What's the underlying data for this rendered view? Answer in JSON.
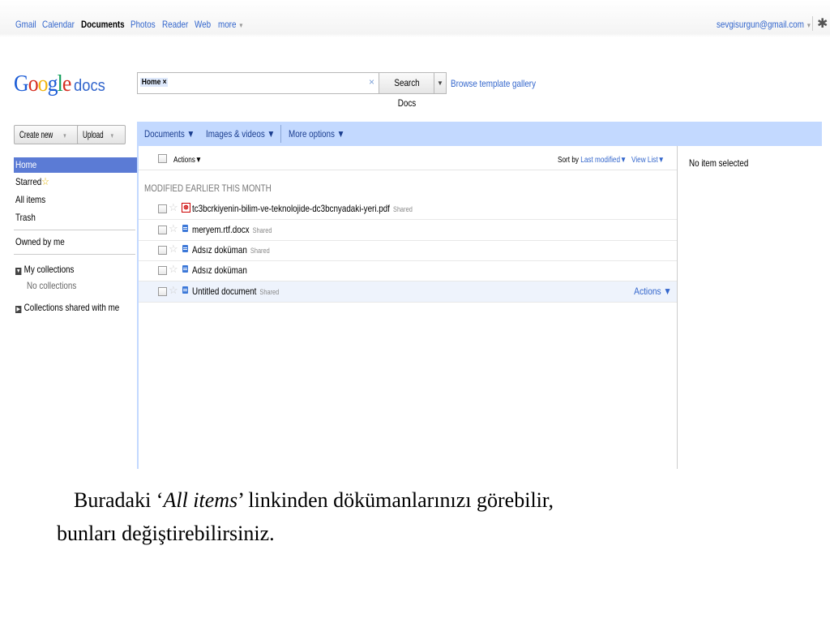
{
  "topnav": {
    "links": [
      "Gmail",
      "Calendar",
      "Documents",
      "Photos",
      "Reader",
      "Web",
      "more"
    ],
    "account": "sevgisurgun@gmail.com"
  },
  "logo": {
    "google": "Google",
    "docs": "docs"
  },
  "search": {
    "chip": "Home ×",
    "button": "Search Docs",
    "browse": "Browse template gallery"
  },
  "left_buttons": {
    "create": "Create new",
    "upload": "Upload"
  },
  "toolbar": {
    "documents": "Documents ▼",
    "images": "Images & videos ▼",
    "more": "More options ▼"
  },
  "nav": {
    "home": "Home",
    "starred": "Starred",
    "all_items": "All items",
    "trash": "Trash",
    "owned": "Owned by me",
    "my_collections": "My collections",
    "no_collections": "No collections",
    "shared_collections": "Collections shared with me"
  },
  "list": {
    "actions": "Actions▼",
    "sort_prefix": "Sort by",
    "sort_value": "Last modified▼",
    "view": "View List▼",
    "section": "MODIFIED EARLIER THIS MONTH",
    "rows": [
      {
        "name": "tc3bcrkiyenin-bilim-ve-teknolojide-dc3bcnyadaki-yeri.pdf",
        "shared": "Shared",
        "type": "pdf"
      },
      {
        "name": "meryem.rtf.docx",
        "shared": "Shared",
        "type": "doc"
      },
      {
        "name": "Adsız doküman",
        "shared": "Shared",
        "type": "doc"
      },
      {
        "name": "Adsız doküman",
        "shared": "",
        "type": "doc"
      },
      {
        "name": "Untitled document",
        "shared": "Shared",
        "type": "doc"
      }
    ],
    "row_actions": "Actions ▼"
  },
  "details": {
    "none": "No item selected"
  },
  "caption": {
    "pre": "Buradaki ‘",
    "em": "All items",
    "post": "’ linkinden dökümanlarınızı görebilir,",
    "line2": "bunları değiştirebilirsiniz."
  }
}
